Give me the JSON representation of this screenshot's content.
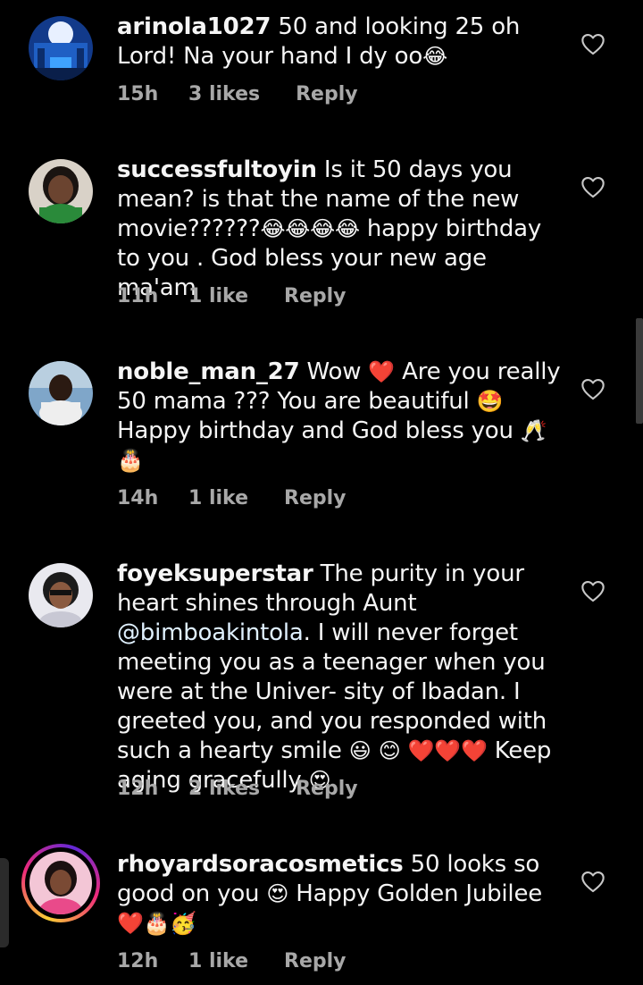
{
  "colors": {
    "background": "#000000",
    "text": "#f5f5f5",
    "meta": "#a8a8a8",
    "mention": "#e0f1ff",
    "heart_red": "#e8142e"
  },
  "comments": [
    {
      "username": "arinola1027",
      "text_parts": [
        "50 and looking 25 oh Lord! Na your hand I dy oo"
      ],
      "emoji_end": "😂",
      "time": "15h",
      "likes": "3 likes",
      "reply": "Reply",
      "like_icon": "heart-outline-icon"
    },
    {
      "username": "successfultoyin",
      "text_a": "Is it 50 days you mean? is that the name of the new movie??????",
      "emoji_mid": "😂😂😂😂",
      "text_b": "happy birthday to you . God bless your new age ma'am",
      "time": "11h",
      "likes": "1 like",
      "reply": "Reply",
      "like_icon": "heart-outline-icon"
    },
    {
      "username": "noble_man_27",
      "text_a": "Wow",
      "emoji_a": "❤️",
      "text_b": "Are you really 50 mama ??? You are beautiful",
      "emoji_b": "🤩",
      "text_c": "Happy birthday and God bless you",
      "emoji_c": "🥂",
      "emoji_d": "🎂",
      "time": "14h",
      "likes": "1 like",
      "reply": "Reply",
      "like_icon": "heart-outline-icon"
    },
    {
      "username": "foyeksuperstar",
      "text_a": "The purity in your heart shines through Aunt",
      "mention": "@bimboakintola",
      "text_b": ". I will never forget meeting you as a teenager when you were at the Univer- sity of Ibadan. I greeted you, and you responded with such a hearty smile",
      "emoji_a": "😃",
      "emoji_b": "😊",
      "emoji_c": "❤️❤️❤️",
      "text_c": "Keep aging gracefully",
      "emoji_d": "😍",
      "time": "12h",
      "likes": "2 likes",
      "reply": "Reply",
      "like_icon": "heart-outline-icon"
    },
    {
      "username": "rhoyardsoracosmetics",
      "text_a": "50 looks so good on you",
      "emoji_a": "😍",
      "text_b": "Happy Golden Jubilee",
      "emoji_b": "❤️🎂🥳",
      "time": "12h",
      "likes": "1 like",
      "reply": "Reply",
      "like_icon": "heart-outline-icon"
    }
  ]
}
